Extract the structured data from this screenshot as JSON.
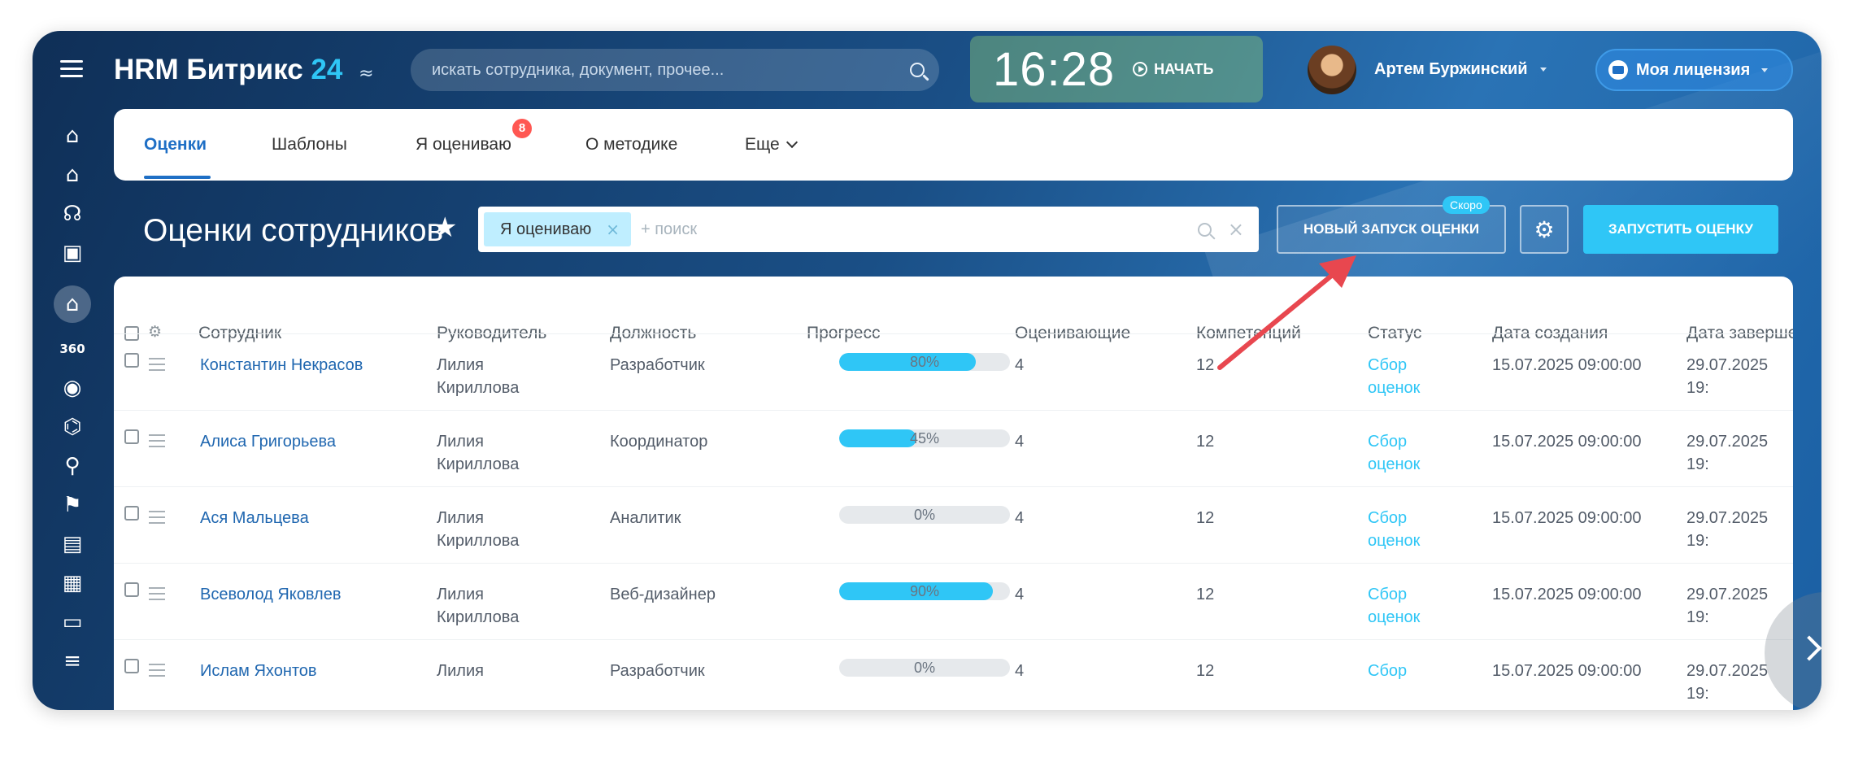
{
  "app": {
    "logo_text": "HRM Битрикс",
    "logo_number": "24",
    "search_placeholder": "искать сотрудника, документ, прочее...",
    "clock_time": "16:28",
    "clock_start_label": "НАЧАТЬ",
    "user_name": "Артем Буржинский",
    "license_label": "Моя лицензия"
  },
  "tabs": [
    {
      "label": "Оценки"
    },
    {
      "label": "Шаблоны"
    },
    {
      "label": "Я оцениваю",
      "badge": "8"
    },
    {
      "label": "О методике"
    },
    {
      "label": "Еще"
    }
  ],
  "page": {
    "title": "Оценки сотрудников",
    "filter_chip": "Я оцениваю",
    "filter_placeholder": "+ поиск",
    "new_launch_label": "НОВЫЙ ЗАПУСК ОЦЕНКИ",
    "soon_badge": "Скоро",
    "start_label": "ЗАПУСТИТЬ ОЦЕНКУ"
  },
  "table": {
    "columns": [
      "Сотрудник",
      "Руководитель",
      "Должность",
      "Прогресс",
      "Оценивающие",
      "Компетенций",
      "Статус",
      "Дата создания",
      "Дата заверше"
    ],
    "rows": [
      {
        "employee": "Константин Некрасов",
        "manager_first": "Лилия",
        "manager_last": "Кириллова",
        "position": "Разработчик",
        "progress": 80,
        "progress_label": "80%",
        "raters": "4",
        "competencies": "12",
        "status_1": "Сбор",
        "status_2": "оценок",
        "created": "15.07.2025 09:00:00",
        "finished": "29.07.2025 19:"
      },
      {
        "employee": "Алиса Григорьева",
        "manager_first": "Лилия",
        "manager_last": "Кириллова",
        "position": "Координатор",
        "progress": 45,
        "progress_label": "45%",
        "raters": "4",
        "competencies": "12",
        "status_1": "Сбор",
        "status_2": "оценок",
        "created": "15.07.2025 09:00:00",
        "finished": "29.07.2025 19:"
      },
      {
        "employee": "Ася Мальцева",
        "manager_first": "Лилия",
        "manager_last": "Кириллова",
        "position": "Аналитик",
        "progress": 0,
        "progress_label": "0%",
        "raters": "4",
        "competencies": "12",
        "status_1": "Сбор",
        "status_2": "оценок",
        "created": "15.07.2025 09:00:00",
        "finished": "29.07.2025 19:"
      },
      {
        "employee": "Всеволод Яковлев",
        "manager_first": "Лилия",
        "manager_last": "Кириллова",
        "position": "Веб-дизайнер",
        "progress": 90,
        "progress_label": "90%",
        "raters": "4",
        "competencies": "12",
        "status_1": "Сбор",
        "status_2": "оценок",
        "created": "15.07.2025 09:00:00",
        "finished": "29.07.2025 19:"
      },
      {
        "employee": "Ислам Яхонтов",
        "manager_first": "Лилия",
        "manager_last": "",
        "position": "Разработчик",
        "progress": 0,
        "progress_label": "0%",
        "raters": "4",
        "competencies": "12",
        "status_1": "Сбор",
        "status_2": "",
        "created": "15.07.2025 09:00:00",
        "finished": "29.07.2025 19:"
      }
    ]
  },
  "colors": {
    "accent": "#2fc6f6",
    "link": "#2067b0",
    "annotation_arrow": "#e8474f",
    "badge": "#ff5752"
  },
  "sidebar_icons": [
    "home-icon",
    "company-icon",
    "headset-icon",
    "document-icon",
    "graduation-cap-icon",
    "360-icon",
    "target-icon",
    "gamepad-icon",
    "share-icon",
    "map-icon",
    "calendar-icon",
    "schedule-icon",
    "card-icon",
    "list-icon"
  ]
}
